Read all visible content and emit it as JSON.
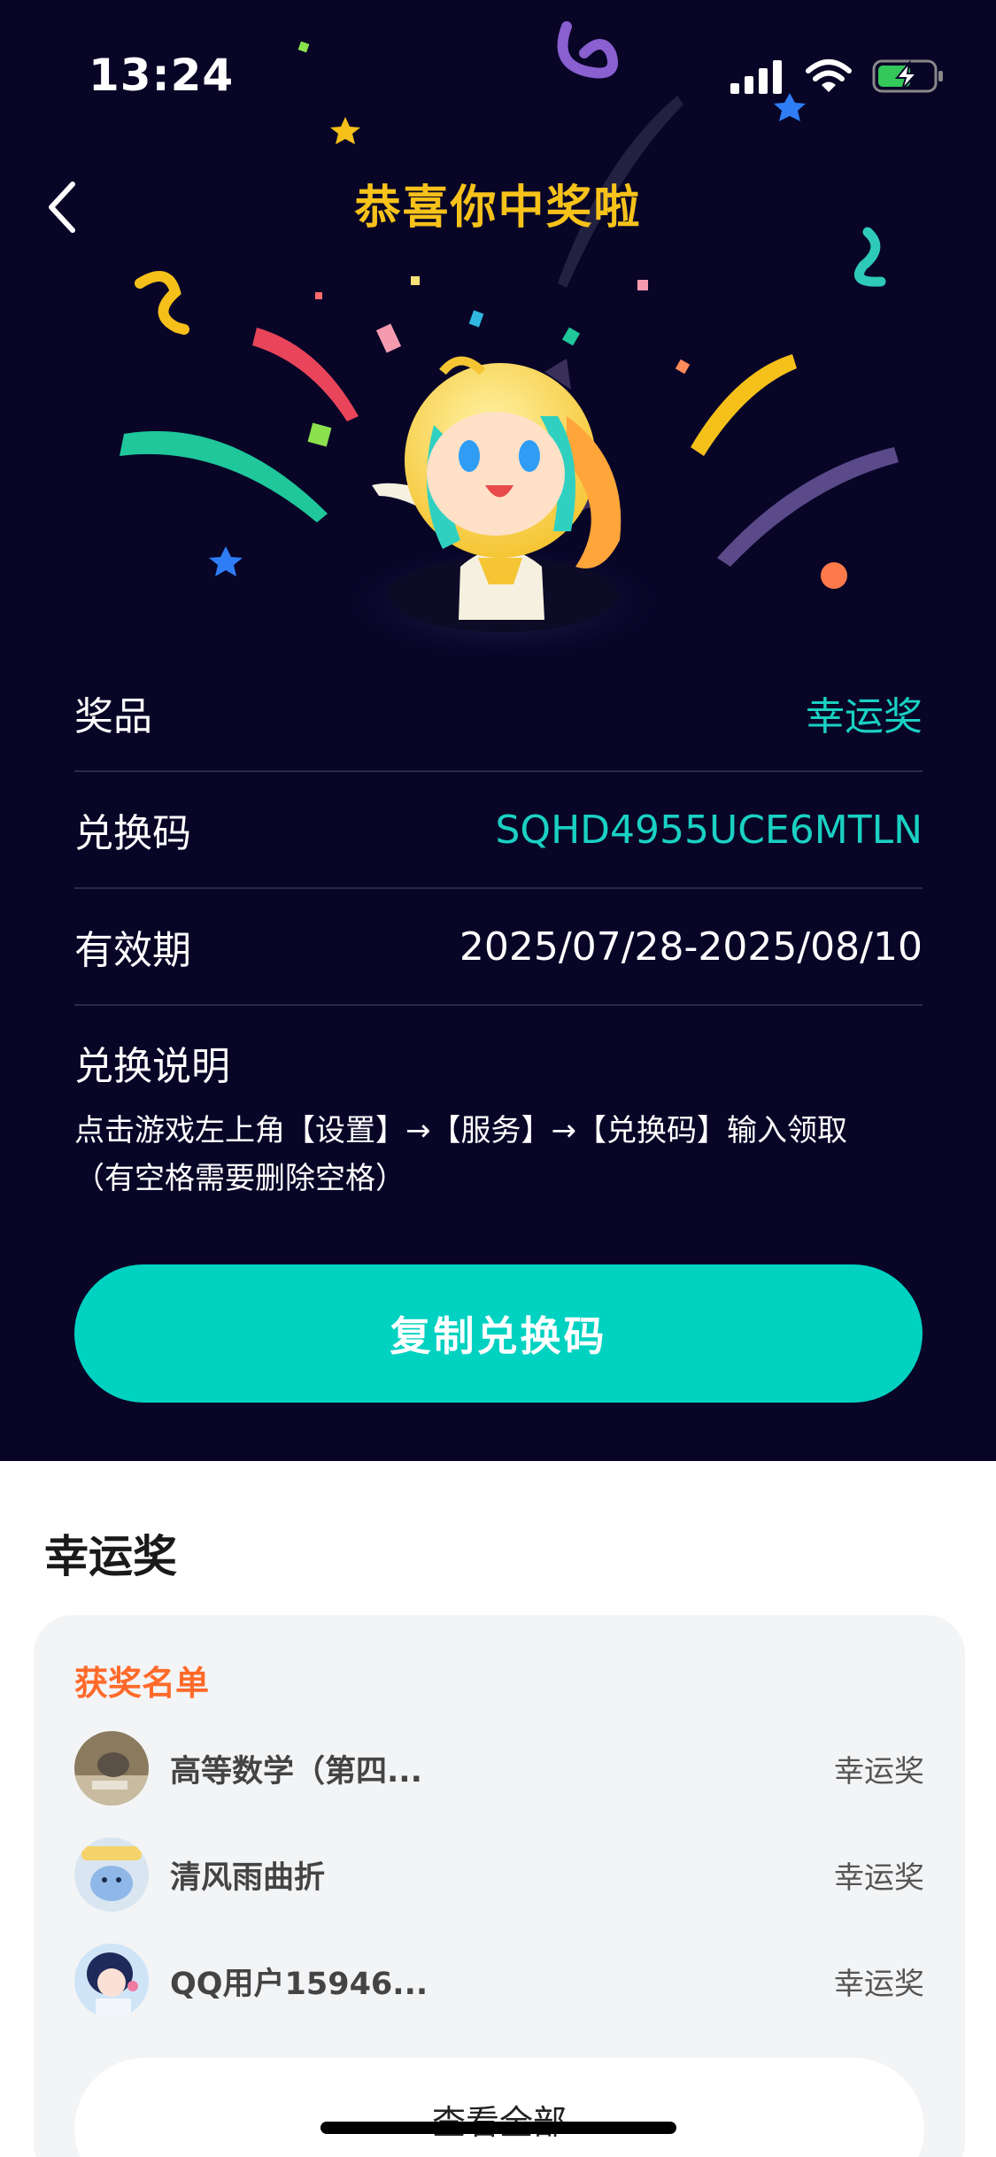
{
  "status_bar": {
    "time": "13:24"
  },
  "header": {
    "title": "恭喜你中奖啦"
  },
  "details": [
    {
      "label": "奖品",
      "value": "幸运奖",
      "style": "teal"
    },
    {
      "label": "兑换码",
      "value": "SQHD4955UCE6MTLN",
      "style": "teal"
    },
    {
      "label": "有效期",
      "value": "2025/07/28-2025/08/10",
      "style": "white"
    }
  ],
  "instructions": {
    "title": "兑换说明",
    "line1": "点击游戏左上角【设置】→【服务】→【兑换码】输入领取",
    "line2": "（有空格需要删除空格）"
  },
  "copy_button": {
    "label": "复制兑换码"
  },
  "prize_section": {
    "title": "幸运奖",
    "list_title": "获奖名单",
    "winners": [
      {
        "name": "高等数学（第四...",
        "prize": "幸运奖",
        "avatar": "photo-avatar"
      },
      {
        "name": "清风雨曲折",
        "prize": "幸运奖",
        "avatar": "cartoon-avatar"
      },
      {
        "name": "QQ用户15946...",
        "prize": "幸运奖",
        "avatar": "anime-girl-avatar"
      }
    ],
    "view_all": "查看全部"
  },
  "colors": {
    "background_dark": "#080527",
    "accent_teal": "#00d2c1",
    "title_gold": "#f7c21a",
    "list_title_orange": "#ff6a2a"
  }
}
